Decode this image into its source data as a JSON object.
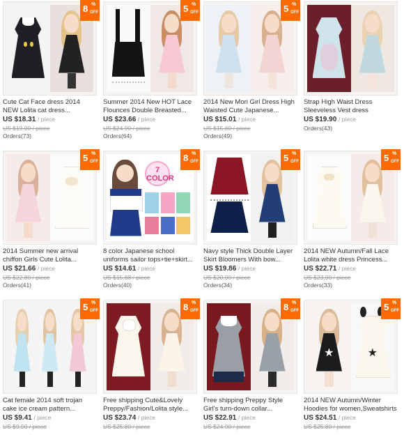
{
  "products": [
    {
      "title": "Cute Cat Face dress 2014 NEW Lolita cat dress...",
      "price": "US $18.31",
      "unit": "/ piece",
      "old_price": "US $19.00 / piece",
      "orders": "Orders(73)",
      "discount": "8",
      "pct": "%",
      "off": "OFF"
    },
    {
      "title": "Summer 2014 New HOT Lace Flounces Double Breasted...",
      "price": "US $23.66",
      "unit": "/ piece",
      "old_price": "US $24.90 / piece",
      "orders": "Orders(64)",
      "discount": "5",
      "pct": "%",
      "off": "OFF"
    },
    {
      "title": "2014 New Mori Girl Dress High Waisted Cute Japanese...",
      "price": "US $15.01",
      "unit": "/ piece",
      "old_price": "US $15.80 / piece",
      "orders": "Orders(49)",
      "discount": "5",
      "pct": "%",
      "off": "OFF"
    },
    {
      "title": "Strap High Waist Dress Sleeveless Vest dress Summer...",
      "price": "US $19.90",
      "unit": "/ piece",
      "old_price": "",
      "orders": "Orders(43)",
      "discount": "",
      "pct": "",
      "off": ""
    },
    {
      "title": "2014 Summer new arrival chiffon Girls Cute Lolita...",
      "price": "US $21.66",
      "unit": "/ piece",
      "old_price": "US $22.80 / piece",
      "orders": "Orders(41)",
      "discount": "5",
      "pct": "%",
      "off": "OFF"
    },
    {
      "title": "8 color Japanese school uniforms sailor tops+tie+skirt...",
      "price": "US $14.61",
      "unit": "/ piece",
      "old_price": "US $15.88 / piece",
      "orders": "Orders(40)",
      "discount": "8",
      "pct": "%",
      "off": "OFF",
      "color_label": "7 COLOR"
    },
    {
      "title": "Navy style Thick Double Layer Skirt Bloomers With bow...",
      "price": "US $19.86",
      "unit": "/ piece",
      "old_price": "US $20.90 / piece",
      "orders": "Orders(34)",
      "discount": "5",
      "pct": "%",
      "off": "OFF"
    },
    {
      "title": "2014 NEW Autumn/Fall Lace Lolita white dress Princess...",
      "price": "US $22.71",
      "unit": "/ piece",
      "old_price": "US $23.90 / piece",
      "orders": "Orders(33)",
      "discount": "5",
      "pct": "%",
      "off": "OFF"
    },
    {
      "title": "Cat female 2014 soft trojan cake ice cream pattern...",
      "price": "US $9.41",
      "unit": "/ piece",
      "old_price": "US $9.90 / piece",
      "orders": "",
      "discount": "5",
      "pct": "%",
      "off": "OFF"
    },
    {
      "title": "Free shipping Cute&Lovely Preppy/Fashion/Lolita style...",
      "price": "US $23.74",
      "unit": "/ piece",
      "old_price": "US $25.80 / piece",
      "orders": "",
      "discount": "8",
      "pct": "%",
      "off": "OFF"
    },
    {
      "title": "Free shipping Preppy Style Girl's turn-down collar...",
      "price": "US $22.91",
      "unit": "/ piece",
      "old_price": "US $24.90 / piece",
      "orders": "",
      "discount": "8",
      "pct": "%",
      "off": "OFF"
    },
    {
      "title": "2014 NEW Autumn/Winter Hoodies for women,Sweatshirts",
      "price": "US $24.51",
      "unit": "/ piece",
      "old_price": "US $25.80 / piece",
      "orders": "",
      "discount": "5",
      "pct": "%",
      "off": "OFF"
    }
  ],
  "colors": {
    "badge": "#ff6a00"
  }
}
